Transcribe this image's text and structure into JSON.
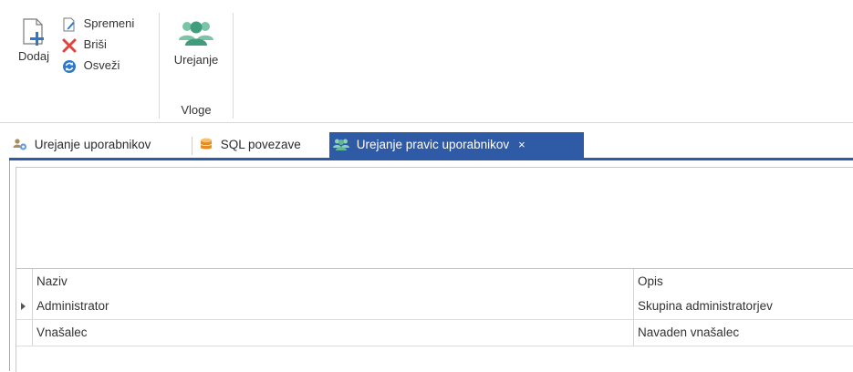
{
  "ribbon": {
    "add_label": "Dodaj",
    "edit_label": "Spremeni",
    "delete_label": "Briši",
    "refresh_label": "Osveži",
    "roles_button_label": "Urejanje",
    "roles_group_label": "Vloge"
  },
  "tabs": [
    {
      "label": "Urejanje uporabnikov",
      "icon": "users-gear-icon",
      "active": false
    },
    {
      "label": "SQL povezave",
      "icon": "database-link-icon",
      "active": false
    },
    {
      "label": "Urejanje pravic uporabnikov",
      "icon": "users-icon",
      "active": true,
      "close": "×"
    }
  ],
  "grid": {
    "columns": [
      "Naziv",
      "Opis"
    ],
    "rows": [
      {
        "naziv": "Administrator",
        "opis": "Skupina administratorjev",
        "current": true
      },
      {
        "naziv": "Vnašalec",
        "opis": "Navaden vnašalec",
        "current": false
      }
    ]
  },
  "colors": {
    "accent": "#2f5aa6",
    "add_plus": "#2d78c8",
    "delete_x": "#e0443a",
    "roles_icon": "#4aa88a"
  }
}
